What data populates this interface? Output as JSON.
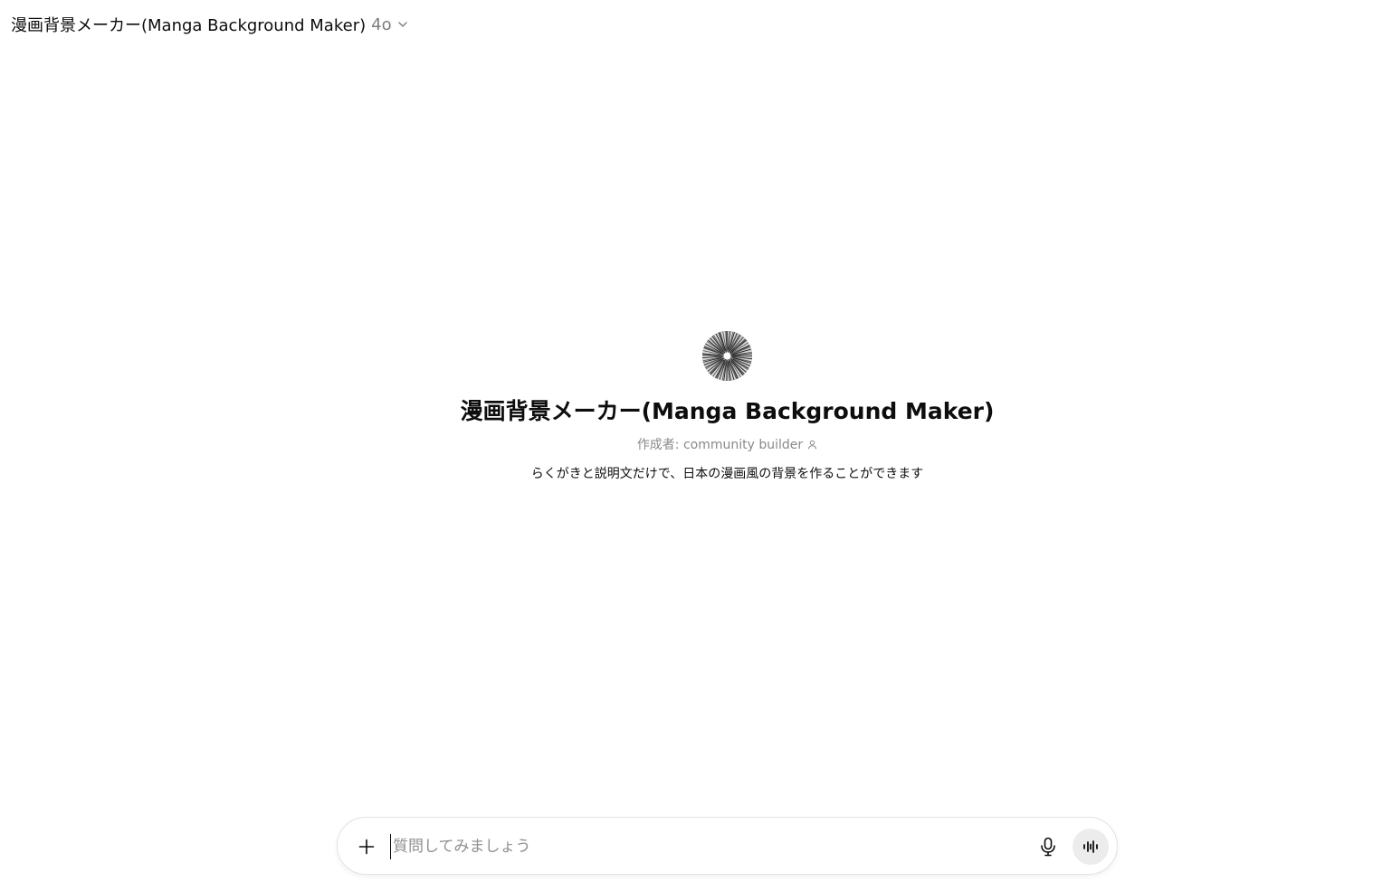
{
  "header": {
    "title": "漫画背景メーカー(Manga Background Maker)",
    "model": "4o",
    "chevron_icon": "chevron-down-icon"
  },
  "gpt": {
    "avatar_icon": "speed-lines-avatar",
    "title": "漫画背景メーカー(Manga Background Maker)",
    "author": "作成者: community builder",
    "author_icon": "person-icon",
    "description": "らくがきと説明文だけで、日本の漫画風の背景を作ることができます"
  },
  "composer": {
    "placeholder": "質問してみましょう",
    "value": "",
    "plus_icon": "plus-icon",
    "mic_icon": "microphone-icon",
    "voice_icon": "voice-mode-icon"
  },
  "colors": {
    "text_primary": "#0d0d0d",
    "text_secondary": "#8a8a8a",
    "voice_button_bg": "#ececec",
    "composer_border": "#e3e3e3"
  }
}
